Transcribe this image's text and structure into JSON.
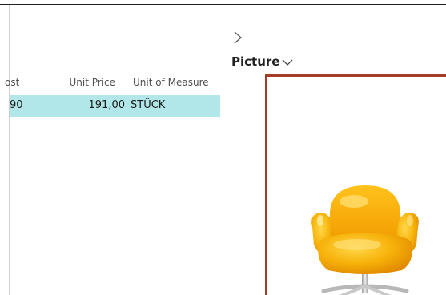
{
  "table": {
    "headers": {
      "cost": "ost",
      "unit_price": "Unit Price",
      "unit_of_measure": "Unit of Measure"
    },
    "rows": [
      {
        "cost": "90",
        "unit_price": "191,00",
        "unit_of_measure": "STÜCK"
      }
    ],
    "selected_row_color": "#b2e7ea"
  },
  "factbox": {
    "title": "Picture",
    "expand_icon": "chevron-right-icon",
    "collapse_icon": "chevron-down-icon",
    "frame_color": "#a33d27",
    "image": "yellow-swan-chair"
  }
}
